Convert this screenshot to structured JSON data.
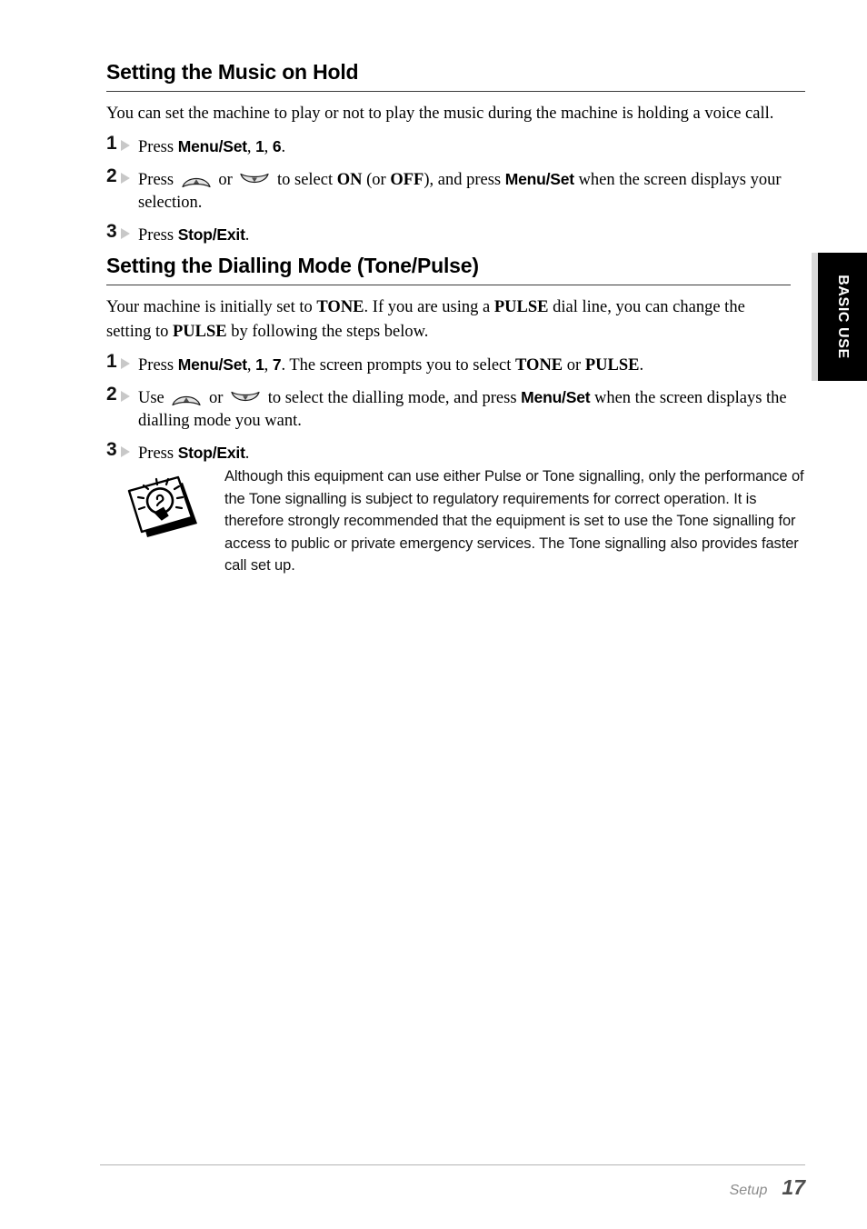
{
  "side_tab": {
    "label": "BASIC USE",
    "background": "#000000",
    "text_color": "#ffffff",
    "gutter_color": "#d9d9d9"
  },
  "sections": [
    {
      "heading": "Setting the Music on Hold",
      "intro": "You can set the machine to play or not to play the music during the machine is holding a voice call.",
      "steps": [
        {
          "number": "1",
          "parts": [
            {
              "type": "text",
              "value": "Press "
            },
            {
              "type": "key",
              "value": "Menu/Set"
            },
            {
              "type": "text",
              "value": ", "
            },
            {
              "type": "key",
              "value": "1"
            },
            {
              "type": "text",
              "value": ", "
            },
            {
              "type": "key",
              "value": "6"
            },
            {
              "type": "text",
              "value": "."
            }
          ]
        },
        {
          "number": "2",
          "parts": [
            {
              "type": "text",
              "value": "Press "
            },
            {
              "type": "icon",
              "value": "up-arrow-key-icon"
            },
            {
              "type": "text",
              "value": " or "
            },
            {
              "type": "icon",
              "value": "down-arrow-key-icon"
            },
            {
              "type": "text",
              "value": " to select "
            },
            {
              "type": "lit",
              "value": "ON"
            },
            {
              "type": "text",
              "value": " (or "
            },
            {
              "type": "lit",
              "value": "OFF"
            },
            {
              "type": "text",
              "value": "), and press "
            },
            {
              "type": "key",
              "value": "Menu/Set"
            },
            {
              "type": "text",
              "value": " when the screen displays your selection."
            }
          ]
        },
        {
          "number": "3",
          "parts": [
            {
              "type": "text",
              "value": "Press "
            },
            {
              "type": "key",
              "value": "Stop/Exit"
            },
            {
              "type": "text",
              "value": "."
            }
          ]
        }
      ]
    },
    {
      "heading": "Setting the Dialling Mode (Tone/Pulse)",
      "intro_parts": [
        {
          "type": "text",
          "value": "Your machine is initially set to "
        },
        {
          "type": "lit",
          "value": "TONE"
        },
        {
          "type": "text",
          "value": ". If you are using a "
        },
        {
          "type": "lit",
          "value": "PULSE"
        },
        {
          "type": "text",
          "value": " dial line, you can change the setting to "
        },
        {
          "type": "lit",
          "value": "PULSE"
        },
        {
          "type": "text",
          "value": " by following the steps below."
        }
      ],
      "steps": [
        {
          "number": "1",
          "parts": [
            {
              "type": "text",
              "value": "Press "
            },
            {
              "type": "key",
              "value": "Menu/Set"
            },
            {
              "type": "text",
              "value": ", "
            },
            {
              "type": "key",
              "value": "1"
            },
            {
              "type": "text",
              "value": ", "
            },
            {
              "type": "key",
              "value": "7"
            },
            {
              "type": "text",
              "value": ". The screen prompts you to select "
            },
            {
              "type": "lit",
              "value": "TONE"
            },
            {
              "type": "text",
              "value": " or "
            },
            {
              "type": "lit",
              "value": "PULSE"
            },
            {
              "type": "text",
              "value": "."
            }
          ]
        },
        {
          "number": "2",
          "parts": [
            {
              "type": "text",
              "value": "Use "
            },
            {
              "type": "icon",
              "value": "up-arrow-key-icon"
            },
            {
              "type": "text",
              "value": " or "
            },
            {
              "type": "icon",
              "value": "down-arrow-key-icon"
            },
            {
              "type": "text",
              "value": " to select the dialling mode, and press "
            },
            {
              "type": "key",
              "value": "Menu/Set"
            },
            {
              "type": "text",
              "value": " when the screen displays the dialling mode you want."
            }
          ]
        },
        {
          "number": "3",
          "parts": [
            {
              "type": "text",
              "value": "Press "
            },
            {
              "type": "key",
              "value": "Stop/Exit"
            },
            {
              "type": "text",
              "value": "."
            }
          ]
        }
      ]
    }
  ],
  "note": {
    "icon": "lightbulb-tip-icon",
    "text": "Although this equipment can use either Pulse or Tone signalling, only the performance of the Tone signalling is subject to regulatory requirements for correct operation. It is therefore strongly recommended that the equipment is set to use the Tone signalling for access to public or private emergency services. The Tone signalling also provides faster call set up."
  },
  "footer": {
    "label": "Setup",
    "page_number": "17"
  }
}
